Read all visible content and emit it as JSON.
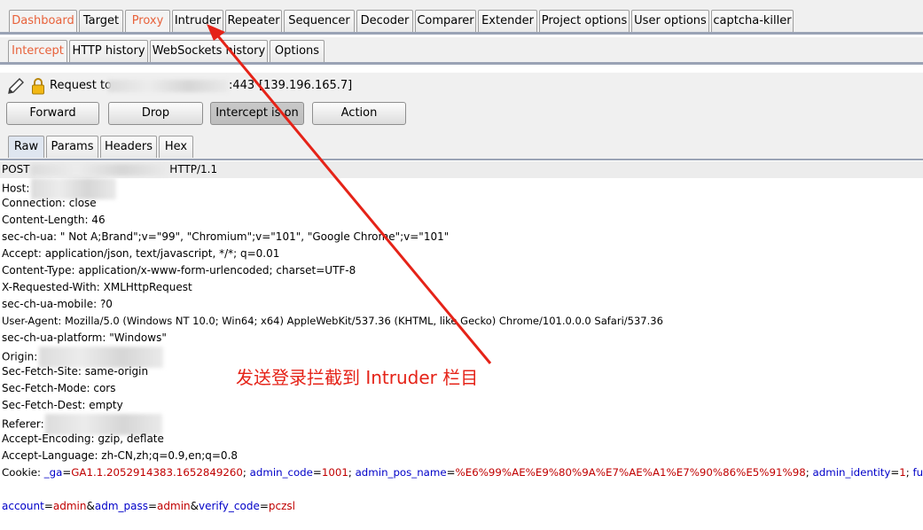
{
  "main_tabs": [
    {
      "label": "Dashboard",
      "active": false
    },
    {
      "label": "Target",
      "active": false
    },
    {
      "label": "Proxy",
      "active": true
    },
    {
      "label": "Intruder",
      "active": false
    },
    {
      "label": "Repeater",
      "active": false
    },
    {
      "label": "Sequencer",
      "active": false
    },
    {
      "label": "Decoder",
      "active": false
    },
    {
      "label": "Comparer",
      "active": false
    },
    {
      "label": "Extender",
      "active": false
    },
    {
      "label": "Project options",
      "active": false
    },
    {
      "label": "User options",
      "active": false
    },
    {
      "label": "captcha-killer",
      "active": false
    }
  ],
  "sub_tabs": [
    {
      "label": "Intercept",
      "active": true
    },
    {
      "label": "HTTP history",
      "active": false
    },
    {
      "label": "WebSockets history",
      "active": false
    },
    {
      "label": "Options",
      "active": false
    }
  ],
  "request_info": {
    "prefix": "Request to",
    "port_suffix": ":443",
    "ip": "[139.196.165.7]"
  },
  "buttons": {
    "forward": "Forward",
    "drop": "Drop",
    "intercept": "Intercept is on",
    "action": "Action"
  },
  "format_tabs": [
    {
      "label": "Raw",
      "active": true
    },
    {
      "label": "Params",
      "active": false
    },
    {
      "label": "Headers",
      "active": false
    },
    {
      "label": "Hex",
      "active": false
    }
  ],
  "request": {
    "method": "POST",
    "protocol": "HTTP/1.1",
    "host_label": "Host:",
    "connection": "Connection: close",
    "content_length": "Content-Length: 46",
    "sec_ch_ua": "sec-ch-ua: \" Not A;Brand\";v=\"99\", \"Chromium\";v=\"101\", \"Google Chrome\";v=\"101\"",
    "accept": "Accept: application/json, text/javascript, */*; q=0.01",
    "content_type": "Content-Type: application/x-www-form-urlencoded; charset=UTF-8",
    "x_requested_with": "X-Requested-With: XMLHttpRequest",
    "sec_ch_ua_mobile": "sec-ch-ua-mobile: ?0",
    "user_agent": "User-Agent: Mozilla/5.0 (Windows NT 10.0; Win64; x64) AppleWebKit/537.36 (KHTML, like Gecko) Chrome/101.0.0.0 Safari/537.36",
    "sec_ch_ua_platform": "sec-ch-ua-platform: \"Windows\"",
    "origin_label": "Origin:",
    "sec_fetch_site": "Sec-Fetch-Site: same-origin",
    "sec_fetch_mode": "Sec-Fetch-Mode: cors",
    "sec_fetch_dest": "Sec-Fetch-Dest: empty",
    "referer_label": "Referer:",
    "accept_encoding": "Accept-Encoding: gzip, deflate",
    "accept_language": "Accept-Language: zh-CN,zh;q=0.9,en;q=0.8",
    "cookie": {
      "label": "Cookie: ",
      "pairs": [
        {
          "name": "_ga",
          "value": "GA1.1.2052914383.1652849260"
        },
        {
          "name": "admin_code",
          "value": "1001"
        },
        {
          "name": "admin_pos_name",
          "value": "%E6%99%AE%E9%80%9A%E7%AE%A1%E7%90%86%E5%91%98"
        },
        {
          "name": "admin_identity",
          "value": "1"
        },
        {
          "name": "fun",
          "value": ""
        }
      ]
    },
    "body": {
      "account_name": "account",
      "account_value": "admin",
      "pass_name": "adm_pass",
      "pass_value": "admin",
      "verify_name": "verify_code",
      "verify_value": "pczsl"
    }
  },
  "annotation": "发送登录拦截到 Intruder 栏目",
  "colors": {
    "active_tab_text": "#e8623b",
    "param_name": "#0000c8",
    "param_value": "#c00000",
    "annotation": "#e52318"
  },
  "icons": [
    "pencil-icon",
    "lock-icon"
  ]
}
